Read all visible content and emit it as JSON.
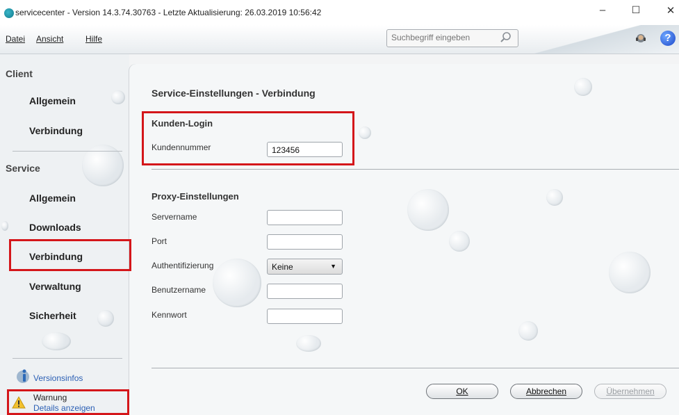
{
  "window": {
    "title": "servicecenter - Version 14.3.74.30763 - Letzte Aktualisierung: 26.03.2019 10:56:42",
    "minimize": "–",
    "maximize": "☐",
    "close": "✕"
  },
  "menubar": {
    "items": [
      {
        "label": "Datei"
      },
      {
        "label": "Ansicht"
      },
      {
        "label": "Hilfe"
      }
    ],
    "search_placeholder": "Suchbegriff eingeben",
    "help_label": "?"
  },
  "sidebar": {
    "client_header": "Client",
    "client_items": [
      {
        "label": "Allgemein"
      },
      {
        "label": "Verbindung"
      }
    ],
    "service_header": "Service",
    "service_items": [
      {
        "label": "Allgemein"
      },
      {
        "label": "Downloads"
      },
      {
        "label": "Verbindung"
      },
      {
        "label": "Verwaltung"
      },
      {
        "label": "Sicherheit"
      }
    ],
    "versions_link": "Versionsinfos",
    "warning_title": "Warnung",
    "warning_link": "Details anzeigen"
  },
  "main": {
    "page_title": "Service-Einstellungen - Verbindung",
    "customer_login": {
      "title": "Kunden-Login",
      "customer_number_label": "Kundennummer",
      "customer_number_value": "123456"
    },
    "proxy": {
      "title": "Proxy-Einstellungen",
      "server_label": "Servername",
      "server_value": "",
      "port_label": "Port",
      "port_value": "",
      "auth_label": "Authentifizierung",
      "auth_value": "Keine",
      "username_label": "Benutzername",
      "username_value": "",
      "password_label": "Kennwort",
      "password_value": ""
    },
    "buttons": {
      "ok": "OK",
      "cancel": "Abbrechen",
      "apply": "Übernehmen"
    }
  },
  "colors": {
    "highlight": "#d4161a",
    "link": "#2b5fb4",
    "panel_bg": "#f5f7f8"
  }
}
